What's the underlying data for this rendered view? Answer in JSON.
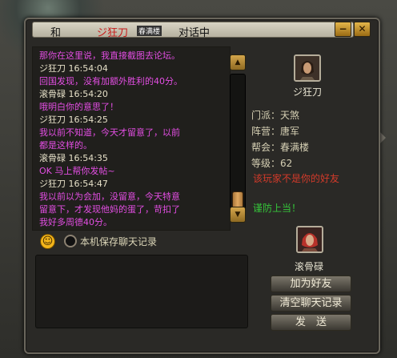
{
  "window": {
    "title_prefix": "和",
    "title_name": "ジ狂刀",
    "title_guild": "春满楼",
    "title_suffix": "对话中",
    "minimize_label": "−",
    "close_label": "✕"
  },
  "chat": {
    "lines": [
      {
        "text": "那你在这里说，我直接截图去论坛。",
        "color": "#e34ee3"
      },
      {
        "text": "ジ狂刀   16:54:04",
        "color": "#e6e0c8"
      },
      {
        "text": "回国发现，没有加额外胜利的40分。",
        "color": "#e34ee3"
      },
      {
        "text": "滚骨碌   16:54:20",
        "color": "#e6e0c8"
      },
      {
        "text": "哦明白你的意思了！",
        "color": "#e34ee3"
      },
      {
        "text": "ジ狂刀   16:54:25",
        "color": "#e6e0c8"
      },
      {
        "text": "我以前不知道，今天才留意了，以前",
        "color": "#e34ee3"
      },
      {
        "text": "都是这样的。",
        "color": "#e34ee3"
      },
      {
        "text": "滚骨碌   16:54:35",
        "color": "#e6e0c8"
      },
      {
        "text": "OK 马上帮你发帖~",
        "color": "#e34ee3"
      },
      {
        "text": "ジ狂刀   16:54:47",
        "color": "#e6e0c8"
      },
      {
        "text": "我以前以为会加，没留意，今天特意",
        "color": "#e34ee3"
      },
      {
        "text": "留意下，才发现他妈的蛋了，苛扣了",
        "color": "#e34ee3"
      },
      {
        "text": "我好多周德40分。",
        "color": "#e34ee3"
      }
    ],
    "save_history_label": "本机保存聊天记录"
  },
  "icons": {
    "scroll_up": "▲",
    "scroll_down": "▼",
    "emote": "☺"
  },
  "partner": {
    "name": "ジ狂刀",
    "sect_label": "门派：",
    "sect_value": "天煞",
    "faction_label": "阵营：",
    "faction_value": "唐军",
    "guild_label": "帮会：",
    "guild_value": "春满楼",
    "level_label": "等级：",
    "level_value": "62",
    "not_friend_warning": "该玩家不是你的好友",
    "caution_text": "谨防上当！"
  },
  "self": {
    "name": "滚骨碌"
  },
  "buttons": {
    "add_friend": "加为好友",
    "clear_history": "清空聊天记录",
    "send": "发　送"
  },
  "colors": {
    "chat_message": "#e34ee3",
    "chat_header": "#e6e0c8",
    "warning_red": "#d33a2a",
    "caution_green": "#35c53a"
  }
}
